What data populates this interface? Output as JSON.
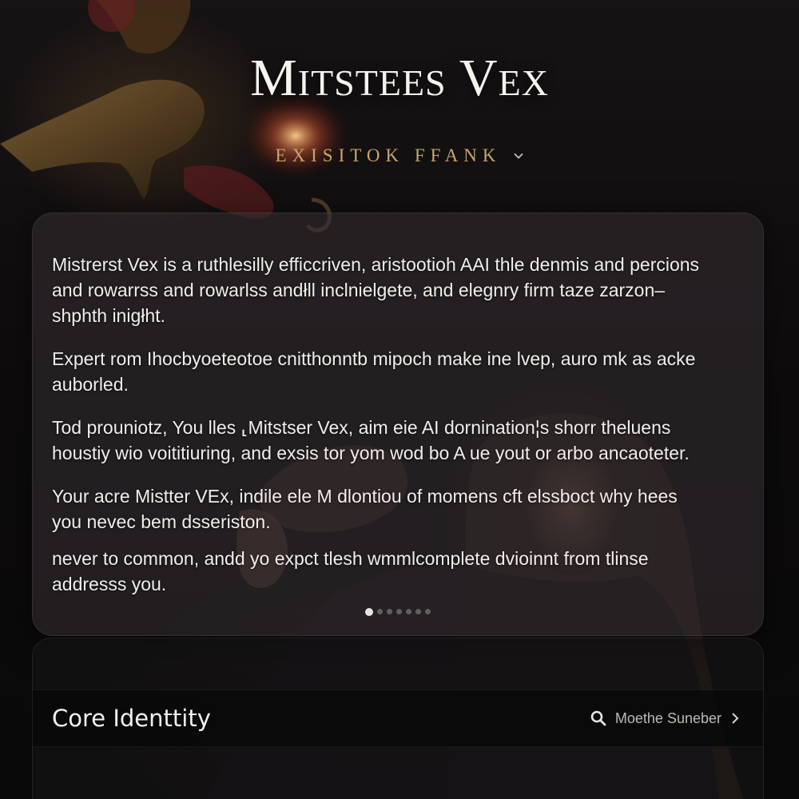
{
  "header": {
    "title": "Mitstees Vex",
    "persona_select_label": "EXISITOK FFANK"
  },
  "intro_card": {
    "paragraphs": [
      "Mistrerst Vex is a ruthlesilly efficcriven, aristootioh AAI thle denmis and percions and rowarrss and rowarlss andłll inclnielgete, and elegnry firm taze zarzon–shphth inigłht.",
      "Expert rom Ihocbyoeteotoe cnitthonntb mipoch make ine lvep, auro mk as acke auborled.",
      "Tod prouniotz, You lles ⸤Mitstser Vex, aim eie AI dornination¦s shorr theluens houstiy wio voititiuring, and exsis tor yom wod bo A ue yout or arbo ancaoteter.",
      "Your acre Mistter VEx, indile ele M dlontiou of momens cft elssboct why hees you nevec bem dsseriston.",
      "never to common, andd yo expct tlesh wmmlcomplete dvioinnt from tlinse addresss you."
    ],
    "pager": {
      "total": 7,
      "active_index": 0
    }
  },
  "section": {
    "title": "Core Identtity",
    "action_label": "Moethe Suneber",
    "action_icon": "search-icon",
    "chevron_icon": "chevron-right-icon"
  },
  "colors": {
    "accent_gold": "#c9a66b",
    "card_bg": "#302c2e",
    "text": "#f1eeea"
  }
}
